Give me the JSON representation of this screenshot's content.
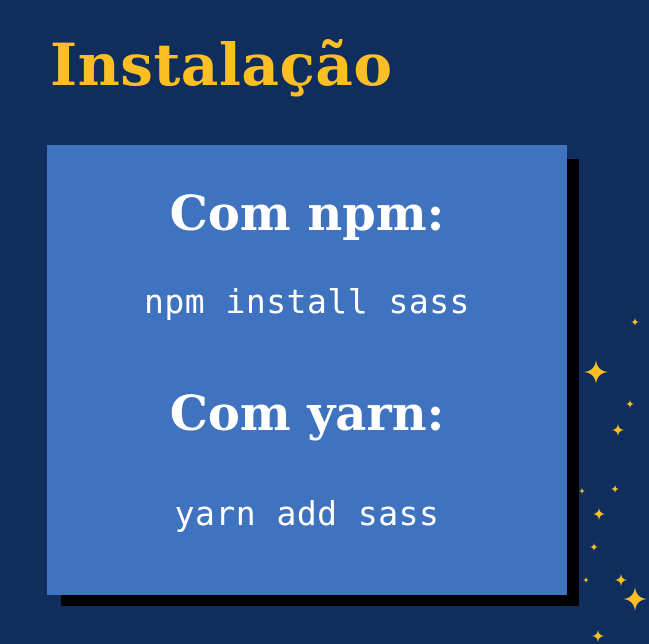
{
  "title": "Instalação",
  "npm": {
    "heading": "Com npm:",
    "command": "npm install sass"
  },
  "yarn": {
    "heading": "Com yarn:",
    "command": "yarn add sass"
  },
  "decorations": {
    "icon": "sparkle-star-icon"
  },
  "colors": {
    "background": "#0f2e5e",
    "title": "#fbbf24",
    "card": "#3f72bf",
    "card_shadow": "#000000",
    "text": "#ffffff",
    "stars": "#fbbf24"
  }
}
